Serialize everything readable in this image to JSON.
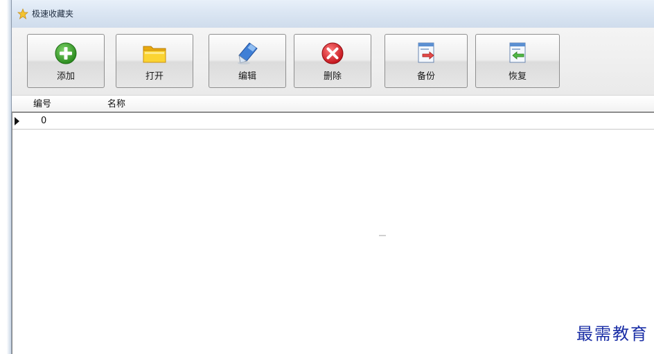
{
  "window": {
    "title": "极速收藏夹"
  },
  "toolbar": {
    "buttons": [
      {
        "label": "添加",
        "icon": "add-circle-icon"
      },
      {
        "label": "打开",
        "icon": "folder-open-icon"
      },
      {
        "label": "编辑",
        "icon": "edit-pencil-icon"
      },
      {
        "label": "删除",
        "icon": "delete-x-icon"
      },
      {
        "label": "备份",
        "icon": "backup-icon"
      },
      {
        "label": "恢复",
        "icon": "restore-icon"
      }
    ]
  },
  "grid": {
    "columns": [
      "编号",
      "名称"
    ],
    "rows": [
      {
        "id": "0",
        "name": ""
      }
    ]
  },
  "watermark": "最需教育",
  "colors": {
    "add": "#3a9a2c",
    "folder": "#f2c21b",
    "delete": "#d9222a",
    "titlebar": "#dbe6f3",
    "watermark": "#1b2fa6"
  }
}
